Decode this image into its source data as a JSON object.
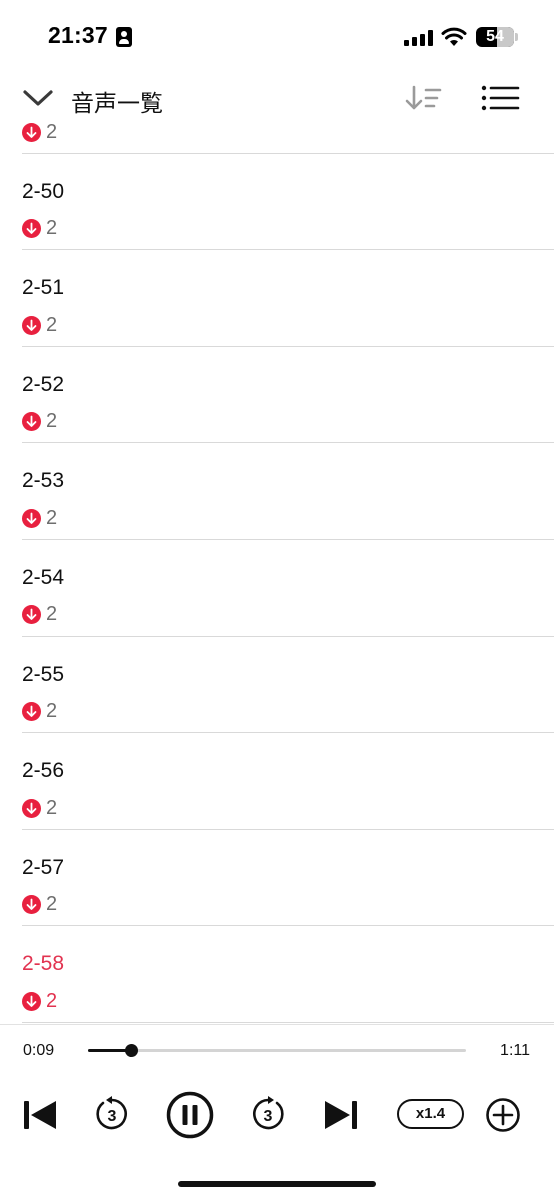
{
  "status_bar": {
    "time": "21:37",
    "battery": "54",
    "battery_level": 0.54
  },
  "header": {
    "title": "音声一覧",
    "icons": [
      "chevron-down-icon",
      "sort-icon",
      "menu-list-icon"
    ]
  },
  "list": {
    "partial_top_count": "2",
    "items": [
      {
        "title": "2-50",
        "count": "2"
      },
      {
        "title": "2-51",
        "count": "2"
      },
      {
        "title": "2-52",
        "count": "2"
      },
      {
        "title": "2-53",
        "count": "2"
      },
      {
        "title": "2-54",
        "count": "2"
      },
      {
        "title": "2-55",
        "count": "2"
      },
      {
        "title": "2-56",
        "count": "2"
      },
      {
        "title": "2-57",
        "count": "2"
      },
      {
        "title": "2-58",
        "count": "2",
        "active": true
      }
    ]
  },
  "player": {
    "elapsed": "0:09",
    "total": "1:11",
    "progress": 0.115,
    "skip_back_label": "3",
    "skip_forward_label": "3",
    "speed": "x1.4"
  },
  "colors": {
    "accent": "#e8203f",
    "active_text": "#e23350",
    "divider": "#d9d9d9"
  }
}
